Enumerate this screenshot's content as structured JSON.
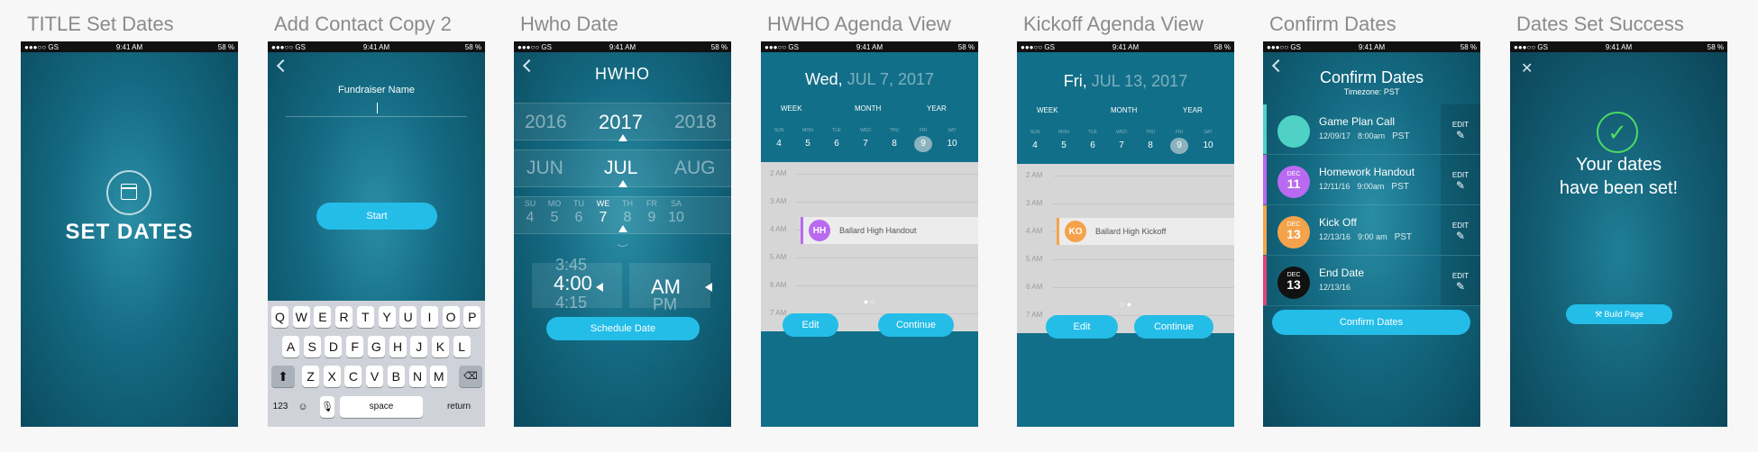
{
  "status": {
    "carrier": "●●●○○ GS",
    "time": "9:41 AM",
    "battery": "58 %"
  },
  "boards": [
    {
      "title": "TITLE Set Dates"
    },
    {
      "title": "Add Contact Copy 2"
    },
    {
      "title": "Hwho Date"
    },
    {
      "title": "HWHO Agenda View"
    },
    {
      "title": "Kickoff Agenda View"
    },
    {
      "title": "Confirm Dates"
    },
    {
      "title": "Dates Set Success"
    }
  ],
  "set_dates": {
    "heading": "SET DATES"
  },
  "add_contact": {
    "label": "Fundraiser Name",
    "start": "Start",
    "row1": [
      "Q",
      "W",
      "E",
      "R",
      "T",
      "Y",
      "U",
      "I",
      "O",
      "P"
    ],
    "row2": [
      "A",
      "S",
      "D",
      "F",
      "G",
      "H",
      "J",
      "K",
      "L"
    ],
    "row3": [
      "Z",
      "X",
      "C",
      "V",
      "B",
      "N",
      "M"
    ],
    "k123": "123",
    "space": "space",
    "return": "return"
  },
  "hwho": {
    "title": "HWHO",
    "years": [
      "2016",
      "2017",
      "2018"
    ],
    "months": [
      "JUN",
      "JUL",
      "AUG"
    ],
    "dow": [
      "SU",
      "MO",
      "TU",
      "WE",
      "TH",
      "FR",
      "SA"
    ],
    "days": [
      "4",
      "5",
      "6",
      "7",
      "8",
      "9",
      "10"
    ],
    "time_prev": "3:45",
    "time": "4:00",
    "time_next": "4:15",
    "ampm": "AM",
    "ampm_next": "PM",
    "schedule": "Schedule Date"
  },
  "agenda_hwho": {
    "weekday": "Wed,",
    "date": "JUL 7, 2017",
    "tabs": [
      "WEEK",
      "MONTH",
      "YEAR"
    ],
    "dow": [
      "SUN",
      "MON",
      "TUE",
      "WED",
      "THU",
      "FRI",
      "SAT"
    ],
    "days": [
      "4",
      "5",
      "6",
      "7",
      "8",
      "9",
      "10"
    ],
    "hours": [
      "2 AM",
      "3 AM",
      "4 AM",
      "5 AM",
      "6 AM",
      "7 AM"
    ],
    "event_badge": "HH",
    "event_title": "Ballard High Handout",
    "edit": "Edit",
    "continue": "Continue"
  },
  "agenda_kickoff": {
    "weekday": "Fri,",
    "date": "JUL 13, 2017",
    "tabs": [
      "WEEK",
      "MONTH",
      "YEAR"
    ],
    "dow": [
      "SUN",
      "MON",
      "TUE",
      "WED",
      "THU",
      "FRI",
      "SAT"
    ],
    "days": [
      "4",
      "5",
      "6",
      "7",
      "8",
      "9",
      "10"
    ],
    "hours": [
      "2 AM",
      "3 AM",
      "4 AM",
      "5 AM",
      "6 AM",
      "7 AM"
    ],
    "event_badge": "KO",
    "event_title": "Ballard High Kickoff",
    "edit": "Edit",
    "continue": "Continue"
  },
  "confirm": {
    "title": "Confirm Dates",
    "timezone": "Timezone: PST",
    "edit": "EDIT",
    "items": [
      {
        "name": "Game Plan Call",
        "date": "12/09/17",
        "time": "8:00am",
        "tz": "PST",
        "mon": "",
        "day": ""
      },
      {
        "name": "Homework Handout",
        "date": "12/11/16",
        "time": "9:00am",
        "tz": "PST",
        "mon": "DEC",
        "day": "11"
      },
      {
        "name": "Kick Off",
        "date": "12/13/16",
        "time": "9:00 am",
        "tz": "PST",
        "mon": "DEC",
        "day": "13"
      },
      {
        "name": "End Date",
        "date": "12/13/16",
        "time": "",
        "tz": "",
        "mon": "DEC",
        "day": "13"
      }
    ],
    "button": "Confirm Dates"
  },
  "success": {
    "line1": "Your dates",
    "line2": "have been set!",
    "button": "Build Page"
  },
  "colors": {
    "accent": "#23bde8",
    "teal": "#4fd1c5",
    "purple": "#b96af0",
    "orange": "#f5a34b",
    "black": "#111111",
    "green": "#4cd964",
    "pink": "#e0437a"
  }
}
